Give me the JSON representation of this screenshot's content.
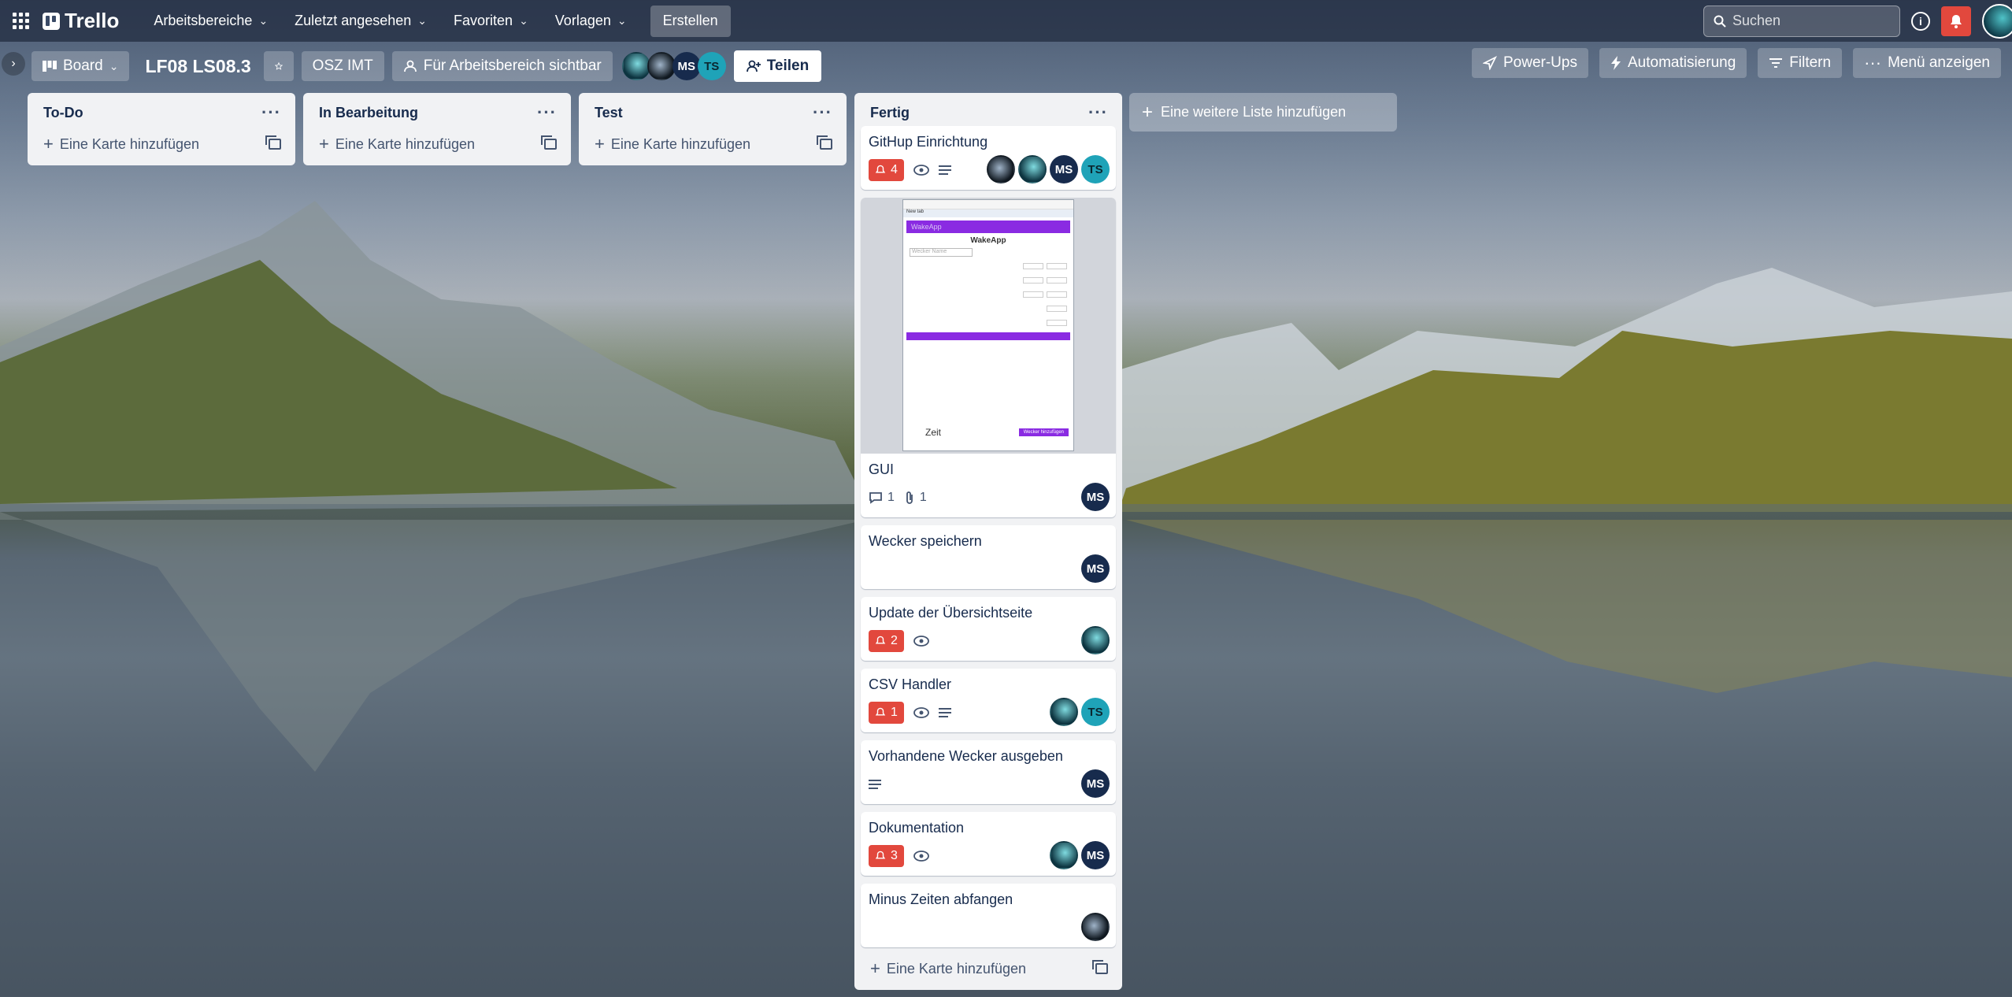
{
  "topnav": {
    "brand": "Trello",
    "menus": [
      "Arbeitsbereiche",
      "Zuletzt angesehen",
      "Favoriten",
      "Vorlagen"
    ],
    "create": "Erstellen",
    "search_placeholder": "Suchen"
  },
  "board": {
    "view_label": "Board",
    "title": "LF08 LS08.3",
    "workspace": "OSZ IMT",
    "visibility": "Für Arbeitsbereich sichtbar",
    "members": [
      "MS",
      "TS"
    ],
    "share": "Teilen",
    "powerups": "Power-Ups",
    "automation": "Automatisierung",
    "filter": "Filtern",
    "menu": "Menü anzeigen"
  },
  "lists": [
    {
      "title": "To-Do",
      "add_card": "Eine Karte hinzufügen"
    },
    {
      "title": "In Bearbeitung",
      "add_card": "Eine Karte hinzufügen"
    },
    {
      "title": "Test",
      "add_card": "Eine Karte hinzufügen"
    },
    {
      "title": "Fertig",
      "add_card": "Eine Karte hinzufügen"
    }
  ],
  "cards": [
    {
      "title": "GitHup Einrichtung",
      "notifications": "4",
      "members": [
        "MS",
        "TS"
      ]
    },
    {
      "title": "GUI",
      "comments": "1",
      "attachments": "1",
      "members": [
        "MS"
      ],
      "cover": {
        "tab": "New tab",
        "header": "WakeApp",
        "app_title": "WakeApp",
        "field": "Wecker Name",
        "time_label": "Zeit",
        "button": "Wecker hinzufügen"
      }
    },
    {
      "title": "Wecker speichern",
      "members": [
        "MS"
      ]
    },
    {
      "title": "Update der Übersichtseite",
      "notifications": "2"
    },
    {
      "title": "CSV Handler",
      "notifications": "1",
      "members": [
        "TS"
      ]
    },
    {
      "title": "Vorhandene Wecker ausgeben",
      "members": [
        "MS"
      ]
    },
    {
      "title": "Dokumentation",
      "notifications": "3",
      "members": [
        "MS"
      ]
    },
    {
      "title": "Minus Zeiten abfangen"
    }
  ],
  "add_list": "Eine weitere Liste hinzufügen",
  "colors": {
    "accent_red": "#e2483d",
    "list_bg": "#f1f2f4",
    "ms_avatar": "#172b4d",
    "ts_avatar": "#1fa3b8"
  }
}
